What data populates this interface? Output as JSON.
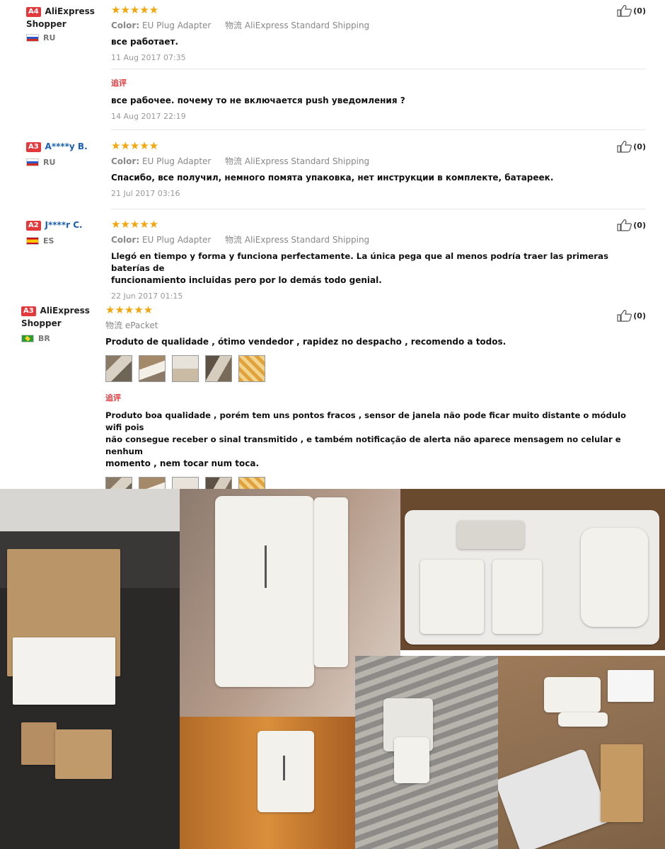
{
  "reviews": [
    {
      "badge": "A4",
      "user_name": "AliExpress Shopper",
      "country": "RU",
      "stars": "★★★★★",
      "color_label": "Color:",
      "color_value": "EU Plug Adapter",
      "shipping_label": "物流",
      "shipping_value": "AliExpress Standard Shipping",
      "text": "все работает.",
      "date": "11 Aug 2017 07:35",
      "helpful": "(0)",
      "followup_label": "追评",
      "followup_text": "все рабочее. почему то не включается push уведомления ?",
      "followup_date": "14 Aug 2017 22:19"
    },
    {
      "badge": "A3",
      "user_name": "A****y B.",
      "country": "RU",
      "stars": "★★★★★",
      "color_label": "Color:",
      "color_value": "EU Plug Adapter",
      "shipping_label": "物流",
      "shipping_value": "AliExpress Standard Shipping",
      "text": "Спасибо, все получил, немного помята упаковка, нет инструкции в комплекте, батареек.",
      "date": "21 Jul 2017 03:16",
      "helpful": "(0)"
    },
    {
      "badge": "A2",
      "user_name": "J****r C.",
      "country": "ES",
      "stars": "★★★★★",
      "color_label": "Color:",
      "color_value": "EU Plug Adapter",
      "shipping_label": "物流",
      "shipping_value": "AliExpress Standard Shipping",
      "text_line1": "Llegó en tiempo y forma y funciona perfectamente. La única pega que al menos podría traer las primeras baterías de",
      "text_line2": "funcionamiento incluidas pero por lo demás todo genial.",
      "date": "22 Jun 2017 01:15",
      "helpful": "(0)"
    },
    {
      "badge": "A3",
      "user_name": "AliExpress Shopper",
      "country": "BR",
      "stars": "★★★★★",
      "shipping_label": "物流",
      "shipping_value": "ePacket",
      "text": "Produto de qualidade , ótimo vendedor , rapidez no despacho , recomendo a todos.",
      "helpful": "(0)",
      "followup_label": "追评",
      "followup_line1": "Produto boa qualidade , porém tem uns pontos fracos , sensor de janela não pode ficar muito distante o módulo wifi pois",
      "followup_line2": "não consegue receber o sinal transmitido , e também notificação de alerta não aparece mensagem no celular e nenhum",
      "followup_line3": "momento , nem tocar num toca."
    }
  ],
  "colors": {
    "badge": "#e4393c",
    "stars": "#f3a60b",
    "link": "#1a5fb4"
  }
}
